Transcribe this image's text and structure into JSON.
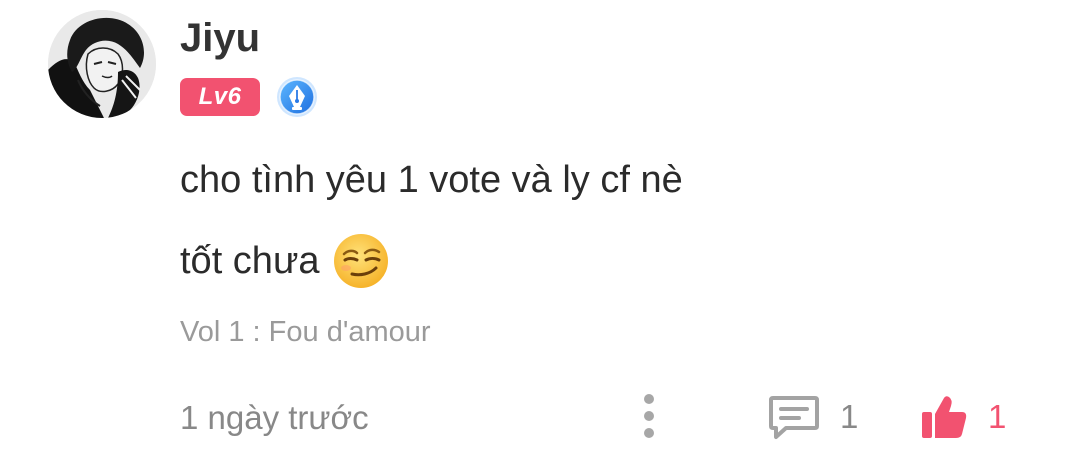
{
  "comment": {
    "author": "Jiyu",
    "level_badge": "Lv6",
    "text_line1": "cho tình yêu 1 vote và ly cf nè",
    "text_line2": "tốt chưa",
    "source": "Vol 1 : Fou d'amour",
    "time": "1 ngày trước",
    "reply_count": "1",
    "like_count": "1"
  },
  "icons": {
    "avatar": "avatar-image",
    "author_badge": "pen-nib-badge-icon",
    "emoji": "smirk-emoji-icon",
    "more": "more-vertical-icon",
    "reply": "comment-icon",
    "like": "thumbs-up-icon"
  },
  "colors": {
    "accent": "#f25270",
    "text": "#2b2b2b",
    "muted": "#888888",
    "badge_blue": "#2d8ef0"
  }
}
